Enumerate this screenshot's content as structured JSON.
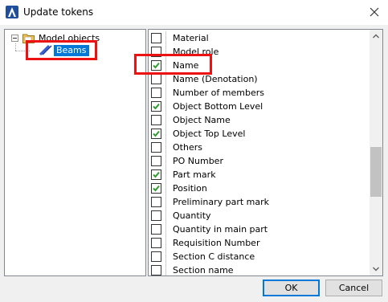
{
  "window": {
    "title": "Update tokens",
    "title_icon": "app-logo-icon",
    "close_icon": "close-icon"
  },
  "tree": {
    "root": {
      "label": "Model objects",
      "icon": "folder-icon",
      "expanded": true
    },
    "child": {
      "label": "Beams",
      "icon": "beam-icon",
      "selected": true
    }
  },
  "list": {
    "items": [
      {
        "label": "Material",
        "checked": false
      },
      {
        "label": "Model role",
        "checked": false
      },
      {
        "label": "Name",
        "checked": true
      },
      {
        "label": "Name (Denotation)",
        "checked": false
      },
      {
        "label": "Number of members",
        "checked": false
      },
      {
        "label": "Object Bottom Level",
        "checked": true
      },
      {
        "label": "Object Name",
        "checked": false
      },
      {
        "label": "Object Top Level",
        "checked": true
      },
      {
        "label": "Others",
        "checked": false
      },
      {
        "label": "PO Number",
        "checked": false
      },
      {
        "label": "Part mark",
        "checked": true
      },
      {
        "label": "Position",
        "checked": true
      },
      {
        "label": "Preliminary part mark",
        "checked": false
      },
      {
        "label": "Quantity",
        "checked": false
      },
      {
        "label": "Quantity in main part",
        "checked": false
      },
      {
        "label": "Requisition Number",
        "checked": false
      },
      {
        "label": "Section C distance",
        "checked": false
      },
      {
        "label": "Section name",
        "checked": false
      }
    ]
  },
  "buttons": {
    "ok": "OK",
    "cancel": "Cancel"
  },
  "colors": {
    "selection": "#0078d7",
    "highlight": "#ee1111",
    "check": "#2f9e2f"
  }
}
